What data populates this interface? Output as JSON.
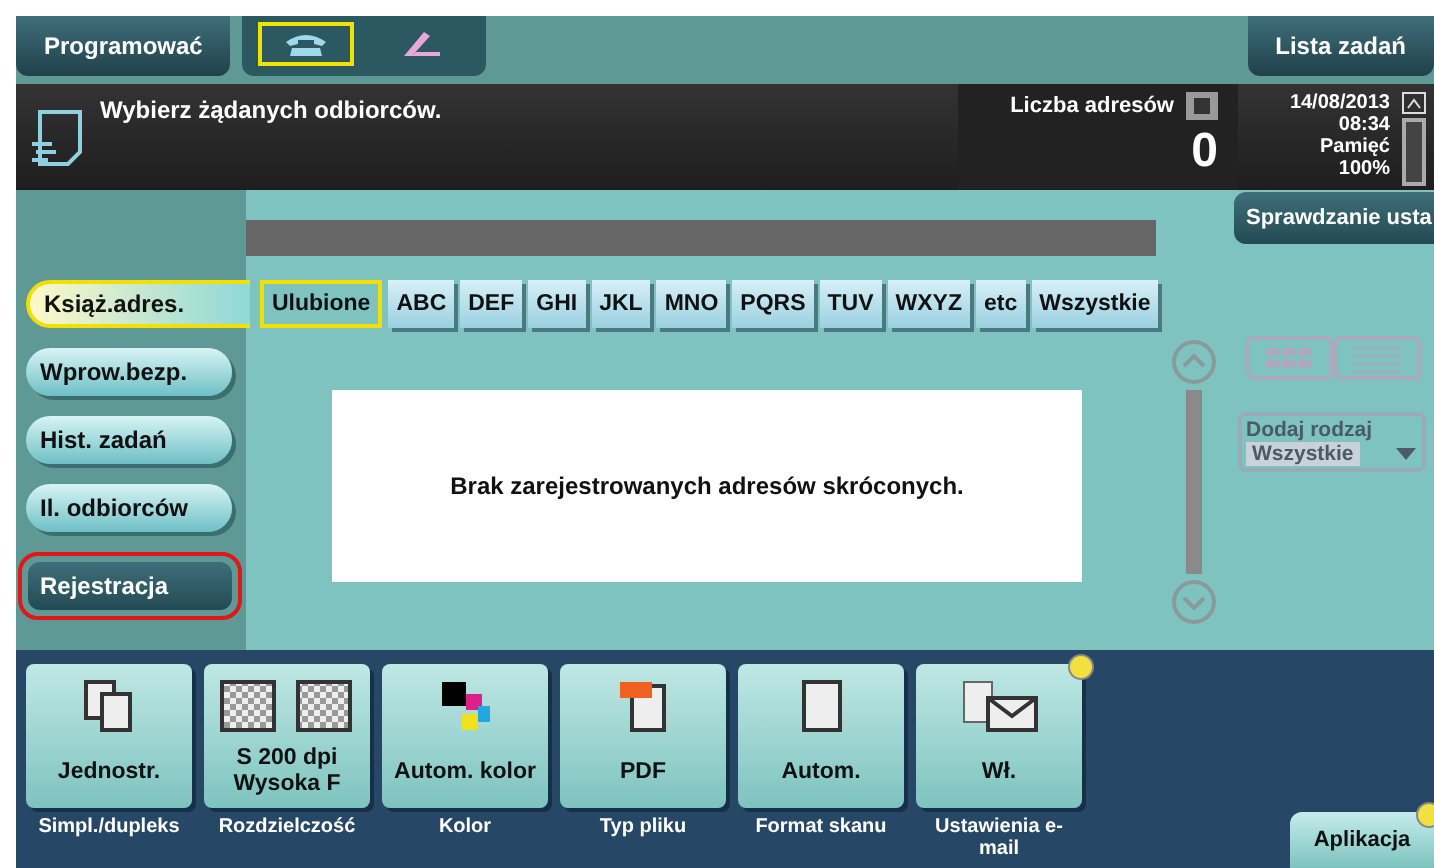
{
  "top_bar": {
    "program_button": "Programować",
    "mode_tabs": [
      {
        "kind": "phone",
        "selected": true
      },
      {
        "kind": "pen",
        "selected": false
      }
    ],
    "job_list_button": "Lista zadań"
  },
  "header": {
    "message": "Wybierz żądanych odbiorców.",
    "address_count_label": "Liczba adresów",
    "address_count": "0",
    "date": "14/08/2013",
    "time": "08:34",
    "memory_label": "Pamięć",
    "memory": "100%"
  },
  "check_settings_button": "Sprawdzanie usta",
  "side_tabs": [
    {
      "label": "Książ.adres.",
      "selected": true
    },
    {
      "label": "Wprow.bezp.",
      "selected": false
    },
    {
      "label": "Hist. zadań",
      "selected": false
    },
    {
      "label": "Il. odbiorców",
      "selected": false
    }
  ],
  "register_button": {
    "label": "Rejestracja",
    "highlighted": true
  },
  "index_tabs": [
    {
      "label": "Ulubione",
      "selected": true
    },
    {
      "label": "ABC",
      "selected": false
    },
    {
      "label": "DEF",
      "selected": false
    },
    {
      "label": "GHI",
      "selected": false
    },
    {
      "label": "JKL",
      "selected": false
    },
    {
      "label": "MNO",
      "selected": false
    },
    {
      "label": "PQRS",
      "selected": false
    },
    {
      "label": "TUV",
      "selected": false
    },
    {
      "label": "WXYZ",
      "selected": false
    },
    {
      "label": "etc",
      "selected": false
    },
    {
      "label": "Wszystkie",
      "selected": false
    }
  ],
  "empty_message": "Brak zarejestrowanych adresów skróconych.",
  "type_filter": {
    "label": "Dodaj rodzaj",
    "value": "Wszystkie",
    "disabled": true
  },
  "settings": [
    {
      "kind": "duplex",
      "value": "Jednostr.",
      "label": "Simpl./dupleks",
      "notice": false
    },
    {
      "kind": "resolution",
      "value": "S 200 dpi Wysoka F",
      "label": "Rozdzielczość",
      "notice": false
    },
    {
      "kind": "color",
      "value": "Autom. kolor",
      "label": "Kolor",
      "notice": false
    },
    {
      "kind": "pdf",
      "value": "PDF",
      "label": "Typ pliku",
      "notice": false
    },
    {
      "kind": "page",
      "value": "Autom.",
      "label": "Format skanu",
      "notice": false
    },
    {
      "kind": "email",
      "value": "Wł.",
      "label": "Ustawienia e-mail",
      "notice": true
    }
  ],
  "app_button": {
    "label": "Aplikacja",
    "notice": true
  }
}
